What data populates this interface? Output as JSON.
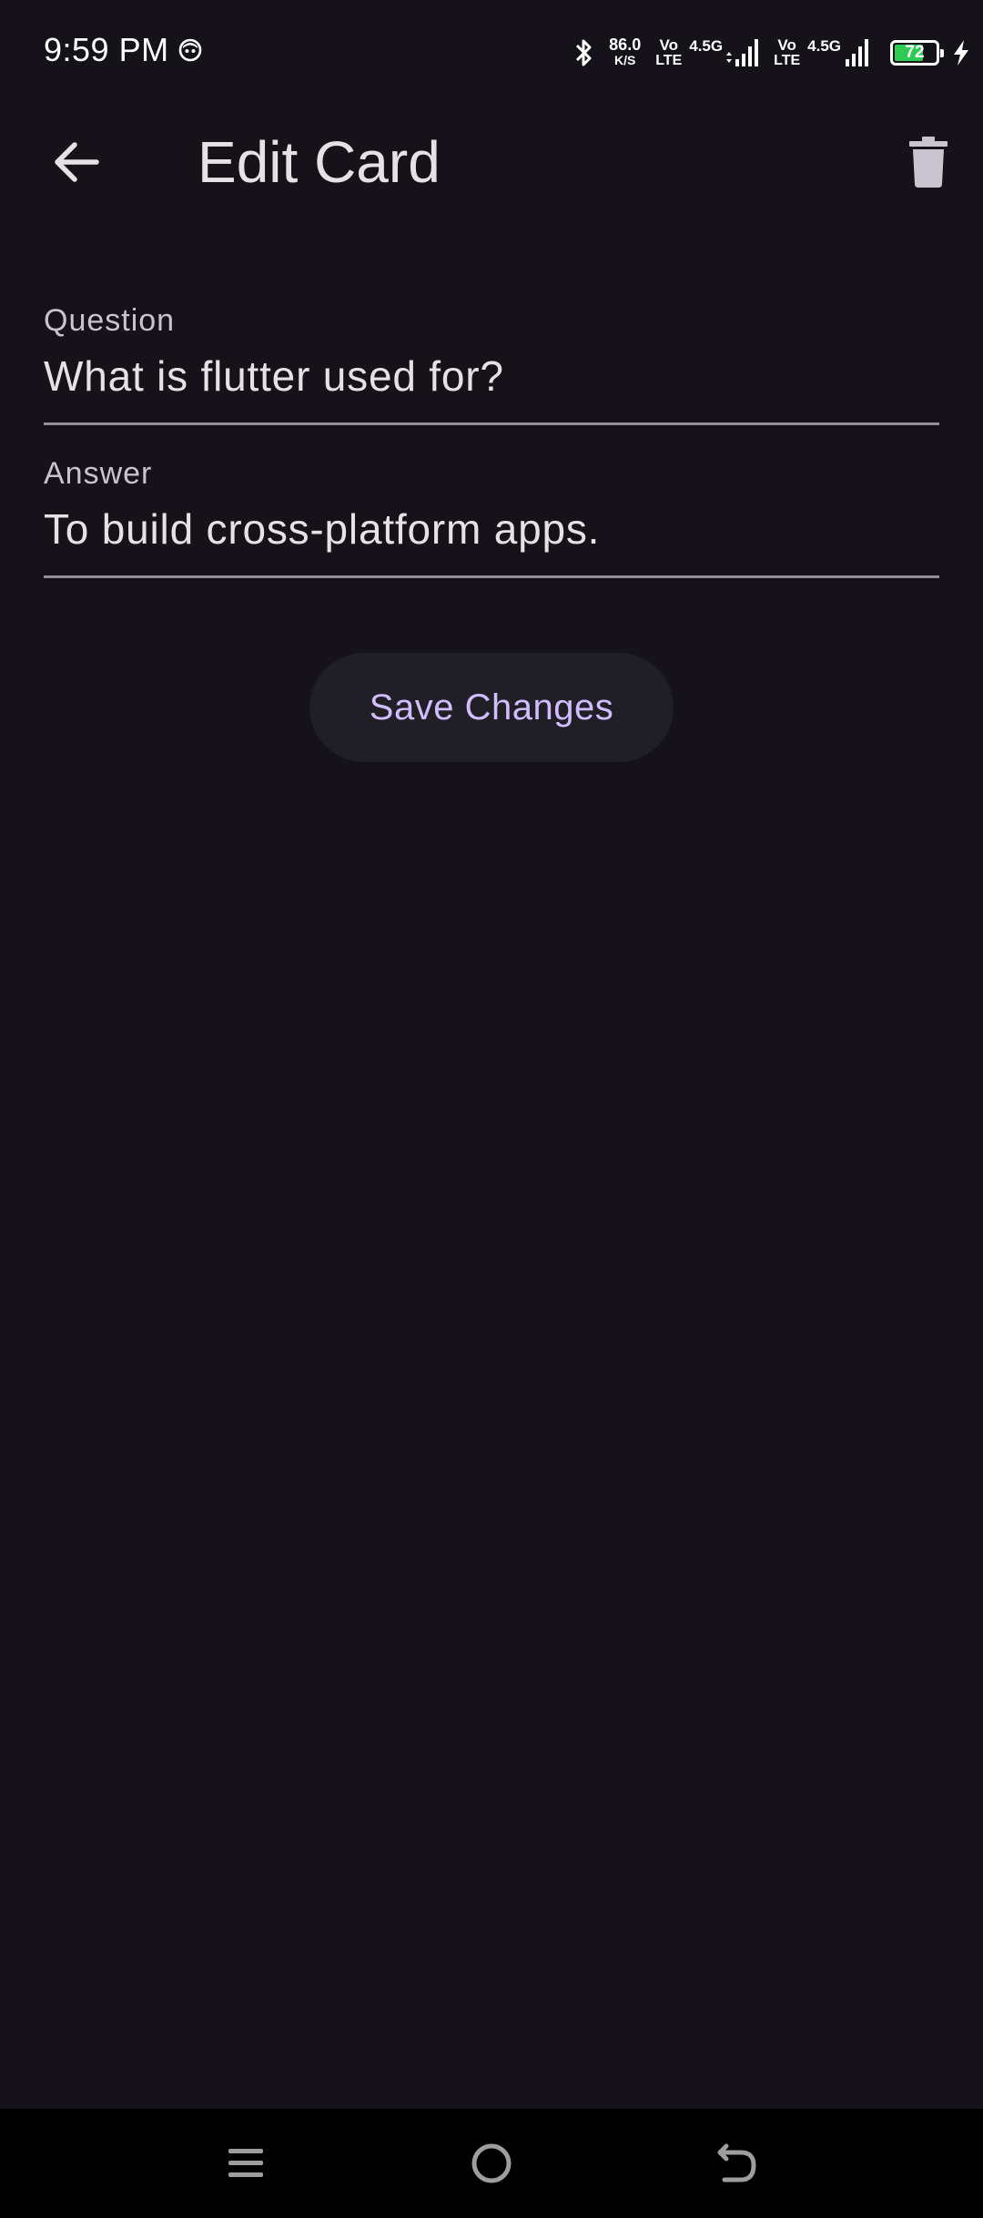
{
  "status_bar": {
    "time": "9:59 PM",
    "net_speed_value": "86.0",
    "net_speed_unit": "K/S",
    "sim1": {
      "volte_top": "Vo",
      "volte_bottom": "LTE",
      "gen": "4.5G"
    },
    "sim2": {
      "volte_top": "Vo",
      "volte_bottom": "LTE",
      "gen": "4.5G"
    },
    "battery_level": "72",
    "battery_color": "#2ecc55",
    "icons": [
      "notification-face-icon",
      "bluetooth-icon",
      "signal-icon",
      "battery-icon",
      "charging-bolt-icon"
    ]
  },
  "app_bar": {
    "title": "Edit Card",
    "back_icon": "arrow-back-icon",
    "delete_icon": "trash-icon"
  },
  "form": {
    "question": {
      "label": "Question",
      "value": "What is flutter used for?"
    },
    "answer": {
      "label": "Answer",
      "value": "To build cross-platform apps."
    }
  },
  "actions": {
    "save_label": "Save Changes"
  },
  "nav_bar": {
    "icons": [
      "menu-icon",
      "home-icon",
      "back-icon"
    ]
  },
  "colors": {
    "background": "#151319",
    "accent": "#d0bcff",
    "button_surface": "#211f26"
  }
}
